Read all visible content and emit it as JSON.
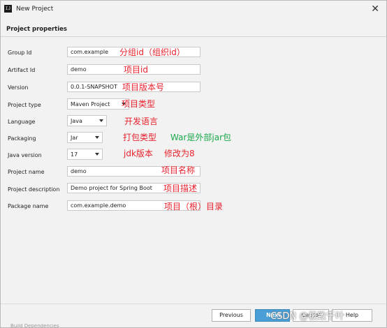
{
  "window": {
    "title": "New Project",
    "app_icon_text": "IJ",
    "close_glyph": "✕"
  },
  "section": {
    "title": "Project properties"
  },
  "fields": {
    "group_id": {
      "label": "Group Id",
      "value": "com.example",
      "note": "分组id（组织id）"
    },
    "artifact_id": {
      "label": "Artifact Id",
      "value": "demo",
      "note": "项目id"
    },
    "version": {
      "label": "Version",
      "value": "0.0.1-SNAPSHOT",
      "note": "项目版本号"
    },
    "project_type": {
      "label": "Project type",
      "value": "Maven Project",
      "note": "项目类型"
    },
    "language": {
      "label": "Language",
      "value": "Java",
      "note": "开发语言"
    },
    "packaging": {
      "label": "Packaging",
      "value": "Jar",
      "note": "打包类型",
      "note2": "War是外部jar包"
    },
    "java_version": {
      "label": "Java version",
      "value": "17",
      "note": "jdk版本",
      "note2": "修改为8"
    },
    "project_name": {
      "label": "Project name",
      "value": "demo",
      "note": "项目名称"
    },
    "project_description": {
      "label": "Project description",
      "value": "Demo project for Spring Boot",
      "note": "项目描述"
    },
    "package_name": {
      "label": "Package name",
      "value": "com.example.demo",
      "note": "项目（根）目录"
    }
  },
  "buttons": {
    "previous": "Previous",
    "next": "Next",
    "cancel": "Cancel",
    "help": "Help"
  },
  "watermark": "CSDN @极致千叶",
  "bottom_strip": "Build     Dependencies",
  "colors": {
    "annotation_red": "#e8222c",
    "annotation_green": "#1aa84a",
    "next_button": "#4a9ed6"
  }
}
